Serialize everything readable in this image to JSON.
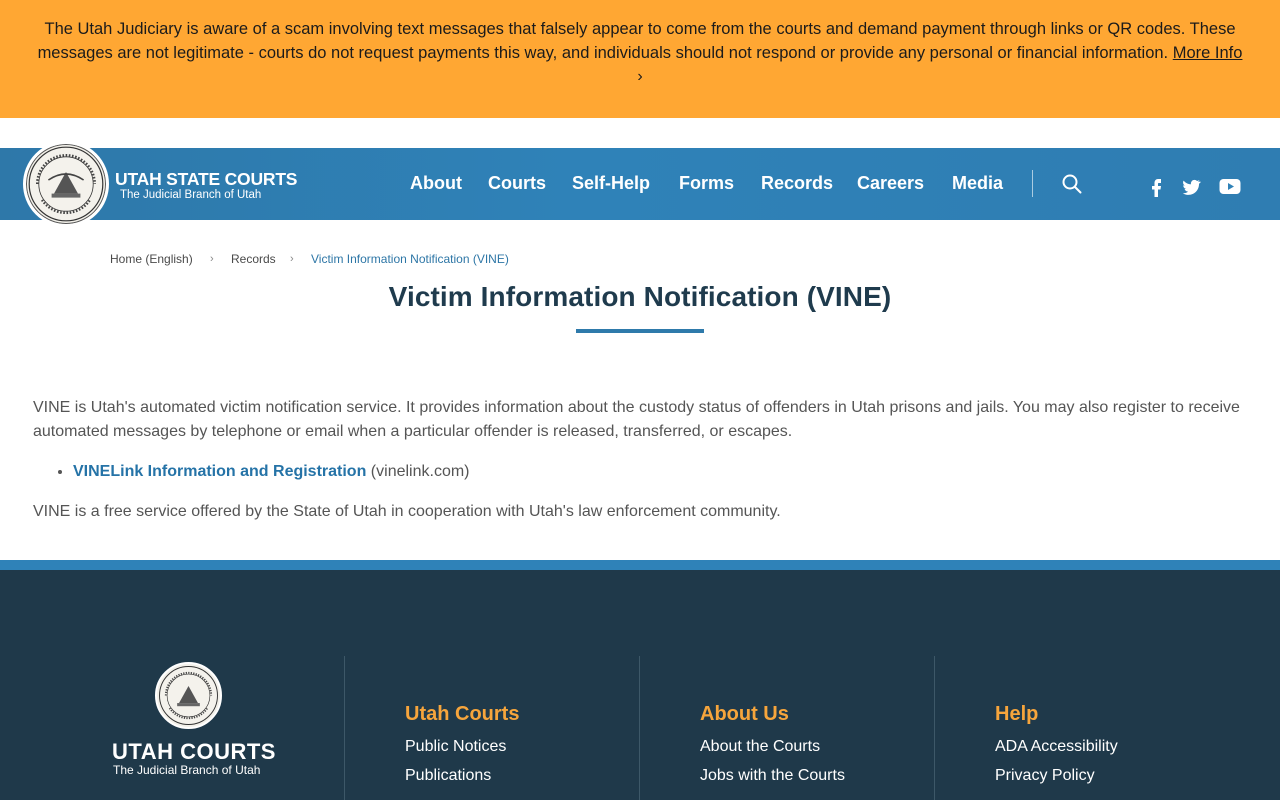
{
  "alert": {
    "message": "The Utah Judiciary is aware of a scam involving text messages that falsely appear to come from the courts and demand payment through links or QR codes. These messages are not legitimate - courts do not request payments this way, and individuals should not respond or provide any personal or financial information.",
    "link_label": "More Info",
    "chevron": "›",
    "background": "#ffa733"
  },
  "header": {
    "brand_title": "UTAH STATE COURTS",
    "brand_subtitle": "The Judicial Branch of Utah",
    "nav": [
      "About",
      "Courts",
      "Self-Help",
      "Forms",
      "Records",
      "Careers",
      "Media"
    ],
    "icons": [
      "search-icon",
      "facebook-icon",
      "twitter-icon",
      "youtube-icon"
    ],
    "background": "#2f82b8"
  },
  "breadcrumb": {
    "items": [
      "Home (English)",
      "Records",
      "Victim Information Notification (VINE)"
    ],
    "separator": "›"
  },
  "page": {
    "title": "Victim Information Notification (VINE)",
    "intro": "VINE is Utah's automated victim notification service. It provides information about the custody status of offenders in Utah prisons and jails. You may also register to receive automated messages by telephone or email when a particular offender is released, transferred, or escapes.",
    "link_label": "VINELink Information and Registration",
    "link_note": " (vinelink.com)",
    "closing": "VINE is a free service offered by the State of Utah in cooperation with Utah's law enforcement community."
  },
  "footer": {
    "brand_title": "UTAH COURTS",
    "brand_subtitle": "The Judicial Branch of Utah",
    "columns": [
      {
        "heading": "Utah Courts",
        "links": [
          "Public Notices",
          "Publications"
        ]
      },
      {
        "heading": "About Us",
        "links": [
          "About the Courts",
          "Jobs with the Courts"
        ]
      },
      {
        "heading": "Help",
        "links": [
          "ADA Accessibility",
          "Privacy Policy"
        ]
      }
    ],
    "heading_color": "#f6a53c",
    "background": "#1f394a"
  }
}
